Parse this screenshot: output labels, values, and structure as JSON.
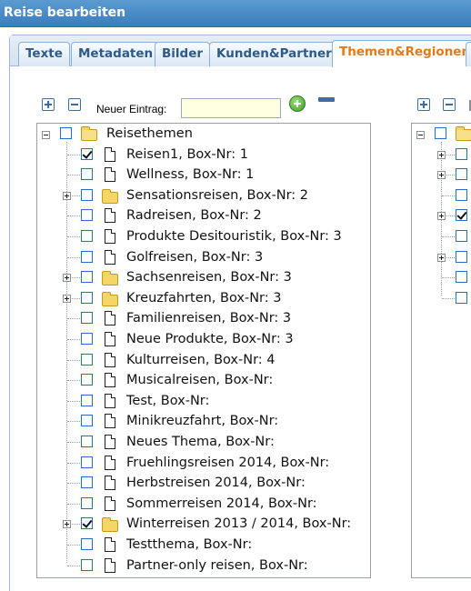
{
  "window": {
    "title": "Reise bearbeiten"
  },
  "tabs": [
    {
      "label": "Texte",
      "active": false
    },
    {
      "label": "Metadaten",
      "active": false
    },
    {
      "label": "Bilder",
      "active": false
    },
    {
      "label": "Kunden&Partner",
      "active": false
    },
    {
      "label": "Themen&Regionen",
      "active": true
    }
  ],
  "toolbar": {
    "expand_all_icon": "plus-square-icon",
    "collapse_all_icon": "minus-square-icon",
    "new_entry_label": "Neuer Eintrag:",
    "new_entry_value": "",
    "add_icon": "green-plus-circle-icon",
    "remove_icon": "minus-bar-icon"
  },
  "tree": {
    "root": {
      "label": "Reisethemen",
      "checked": false,
      "expanded": true
    },
    "items": [
      {
        "label": "Reisen1, Box-Nr: 1",
        "checked": true,
        "type": "doc",
        "expandable": false
      },
      {
        "label": "Wellness, Box-Nr: 1",
        "checked": false,
        "type": "doc",
        "expandable": false
      },
      {
        "label": "Sensationsreisen, Box-Nr: 2",
        "checked": false,
        "type": "folder",
        "expandable": true
      },
      {
        "label": "Radreisen, Box-Nr: 2",
        "checked": false,
        "type": "doc",
        "expandable": false
      },
      {
        "label": "Produkte Desitouristik, Box-Nr: 3",
        "checked": false,
        "type": "doc",
        "expandable": false
      },
      {
        "label": "Golfreisen, Box-Nr: 3",
        "checked": false,
        "type": "doc",
        "expandable": false
      },
      {
        "label": "Sachsenreisen, Box-Nr: 3",
        "checked": false,
        "type": "folder",
        "expandable": true
      },
      {
        "label": "Kreuzfahrten, Box-Nr: 3",
        "checked": false,
        "type": "folder",
        "expandable": true
      },
      {
        "label": "Familienreisen, Box-Nr: 3",
        "checked": false,
        "type": "doc",
        "expandable": false
      },
      {
        "label": "Neue Produkte, Box-Nr: 3",
        "checked": false,
        "type": "doc",
        "expandable": false
      },
      {
        "label": "Kulturreisen, Box-Nr: 4",
        "checked": false,
        "type": "doc",
        "expandable": false
      },
      {
        "label": "Musicalreisen, Box-Nr:",
        "checked": false,
        "type": "doc",
        "expandable": false
      },
      {
        "label": "Test, Box-Nr:",
        "checked": false,
        "type": "doc",
        "expandable": false
      },
      {
        "label": "Minikreuzfahrt, Box-Nr:",
        "checked": false,
        "type": "doc",
        "expandable": false
      },
      {
        "label": "Neues Thema, Box-Nr:",
        "checked": false,
        "type": "doc",
        "expandable": false
      },
      {
        "label": "Fruehlingsreisen 2014, Box-Nr:",
        "checked": false,
        "type": "doc",
        "expandable": false
      },
      {
        "label": "Herbstreisen 2014, Box-Nr:",
        "checked": false,
        "type": "doc",
        "expandable": false
      },
      {
        "label": "Sommerreisen 2014, Box-Nr:",
        "checked": false,
        "type": "doc",
        "expandable": false
      },
      {
        "label": "Winterreisen 2013 / 2014, Box-Nr:",
        "checked": true,
        "type": "folder",
        "expandable": true
      },
      {
        "label": "Testthema, Box-Nr:",
        "checked": false,
        "type": "doc",
        "expandable": false
      },
      {
        "label": "Partner-only reisen, Box-Nr:",
        "checked": false,
        "type": "doc",
        "expandable": false
      }
    ]
  },
  "second_tree": {
    "root": {
      "checked": false,
      "expanded": true
    },
    "items": [
      {
        "checked": false,
        "expandable": true
      },
      {
        "checked": false,
        "expandable": true
      },
      {
        "checked": false,
        "expandable": false
      },
      {
        "checked": true,
        "expandable": true
      },
      {
        "checked": false,
        "expandable": false
      },
      {
        "checked": false,
        "expandable": true
      },
      {
        "checked": false,
        "expandable": false
      },
      {
        "checked": false,
        "expandable": false
      }
    ]
  }
}
